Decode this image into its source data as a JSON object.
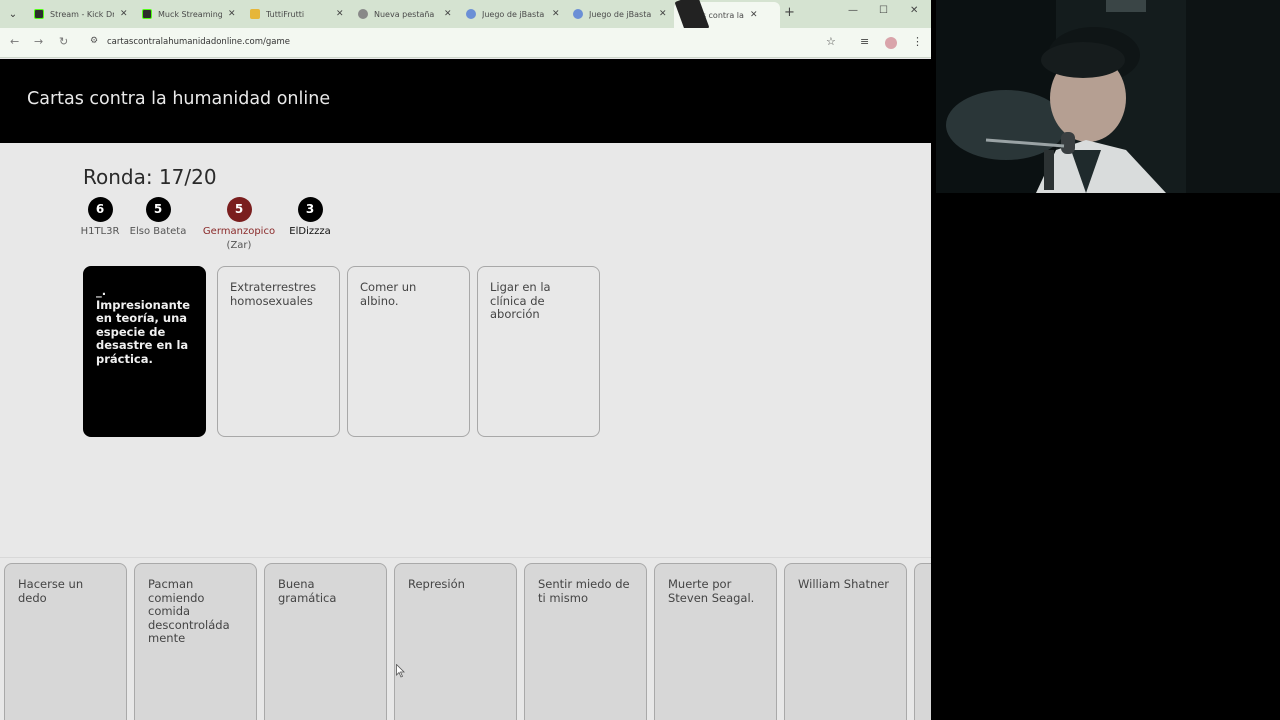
{
  "browser": {
    "tabs": [
      {
        "title": "Stream - Kick Dr",
        "icon": "kick-icon"
      },
      {
        "title": "Muck Streaming",
        "icon": "kick-icon"
      },
      {
        "title": "TuttiFrutti",
        "icon": "tuttifrutti-icon"
      },
      {
        "title": "Nueva pestaña",
        "icon": "chrome-icon"
      },
      {
        "title": "Juego de jBasta",
        "icon": "globe-icon"
      },
      {
        "title": "Juego de jBasta",
        "icon": "globe-icon"
      },
      {
        "title": "Cartas contra la",
        "icon": "cards-icon"
      }
    ],
    "url": "cartascontralahumanidadonline.com/game"
  },
  "page": {
    "title": "Cartas contra la humanidad online",
    "round_label": "Ronda: 17/20",
    "players": [
      {
        "score": "6",
        "name": "H1TL3R",
        "role": ""
      },
      {
        "score": "5",
        "name": "Elso Bateta",
        "role": ""
      },
      {
        "score": "5",
        "name": "Germanzopico",
        "role": "(Zar)"
      },
      {
        "score": "3",
        "name": "ElDizzza",
        "role": ""
      }
    ],
    "black_card": "_. Impresionante en teoría, una especie de desastre en la práctica.",
    "played_cards": [
      "Extraterrestres homosexuales",
      "Comer un albino.",
      "Ligar en la clínica de aborción"
    ],
    "hand_cards": [
      "Hacerse un dedo",
      "Pacman comiendo comida descontroláda mente",
      "Buena gramática",
      "Represión",
      "Sentir miedo de ti mismo",
      "Muerte por Steven Seagal.",
      "William Shatner"
    ]
  },
  "colors": {
    "header_bg": "#000000",
    "page_bg": "#e8e8e8",
    "zar": "#7a1e1e",
    "tabbar": "#d5e3d1"
  }
}
